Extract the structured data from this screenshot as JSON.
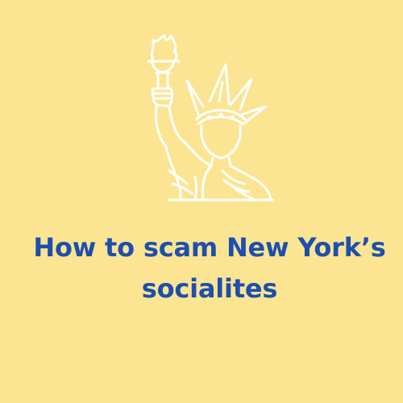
{
  "icon": "statue-of-liberty-icon",
  "colors": {
    "background": "#fce592",
    "title": "#1c4fae",
    "icon_stroke": "#ffffff"
  },
  "title": {
    "line1": "How to scam New York’s",
    "line2": "socialites"
  }
}
